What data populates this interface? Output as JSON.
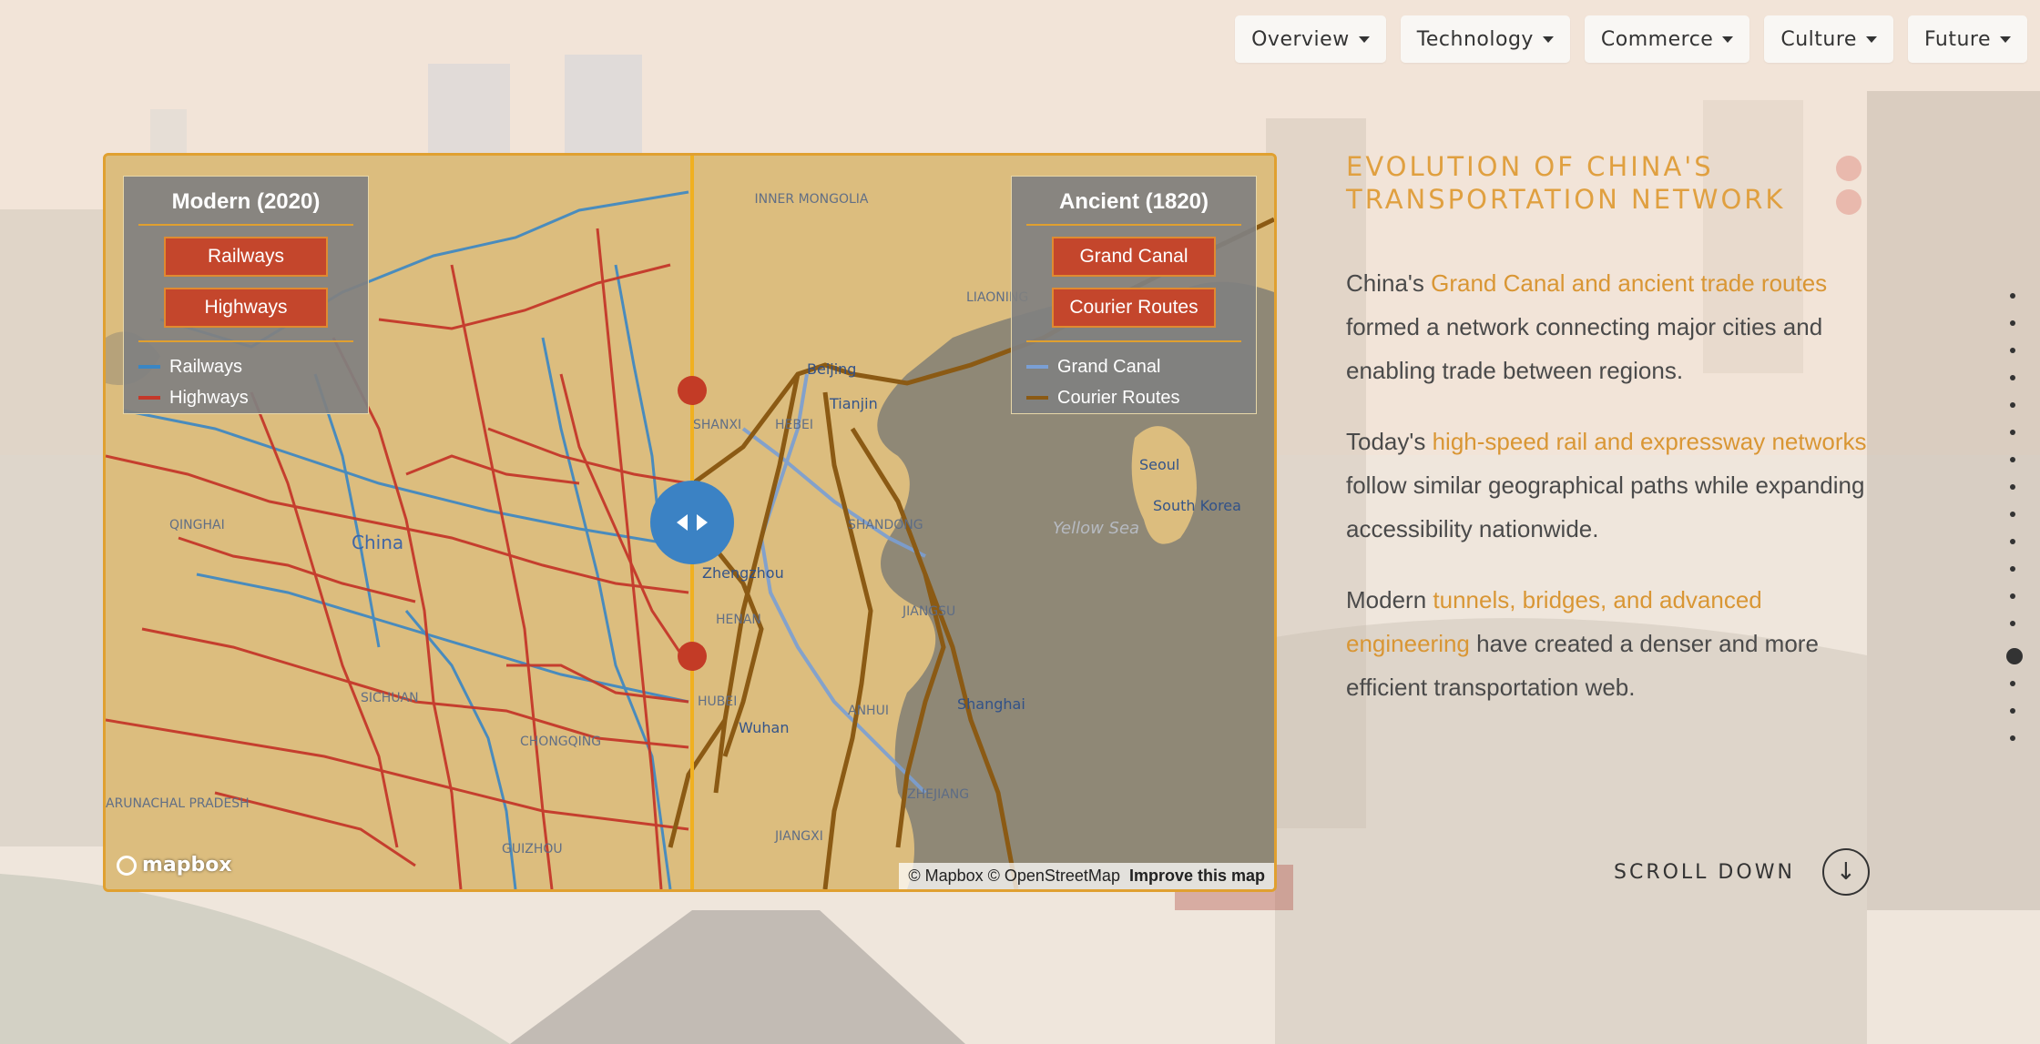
{
  "nav": [
    {
      "label": "Overview"
    },
    {
      "label": "Technology"
    },
    {
      "label": "Commerce"
    },
    {
      "label": "Culture"
    },
    {
      "label": "Future"
    }
  ],
  "map": {
    "modern_legend": {
      "title": "Modern (2020)",
      "buttons": [
        "Railways",
        "Highways"
      ],
      "items": [
        {
          "label": "Railways",
          "color": "#3a86c4"
        },
        {
          "label": "Highways",
          "color": "#c4382a"
        }
      ]
    },
    "ancient_legend": {
      "title": "Ancient (1820)",
      "buttons": [
        "Grand Canal",
        "Courier Routes"
      ],
      "items": [
        {
          "label": "Grand Canal",
          "color": "#7a9fd4"
        },
        {
          "label": "Courier Routes",
          "color": "#8b5a14"
        }
      ]
    },
    "place_labels": [
      "INNER MONGOLIA",
      "Beijing",
      "Tianjin",
      "LIAONING",
      "HEBEI",
      "SHANXI",
      "SHANDONG",
      "Seoul",
      "South Korea",
      "Yellow Sea",
      "QINGHAI",
      "China",
      "Zhengzhou",
      "HENAN",
      "JIANGSU",
      "Shanghai",
      "Wuhan",
      "HUBEI",
      "ANHUI",
      "SICHUAN",
      "CHONGQING",
      "ZHEJIANG",
      "JIANGXI",
      "GUIZHOU",
      "ARUNACHAL PRADESH"
    ],
    "logo_text": "mapbox",
    "attribution": "© Mapbox © OpenStreetMap",
    "improve_link": "Improve this map"
  },
  "content": {
    "heading": "EVOLUTION OF CHINA'S TRANSPORTATION NETWORK",
    "p1_pre": "China's ",
    "p1_hl": "Grand Canal and ancient trade routes",
    "p1_post": " formed a network connecting major cities and enabling trade between regions.",
    "p2_pre": "Today's ",
    "p2_hl": "high-speed rail and expressway networks",
    "p2_post": " follow similar geographical paths while expanding accessibility nationwide.",
    "p3_pre": "Modern ",
    "p3_hl": "tunnels, bridges, and advanced engineering",
    "p3_post": " have created a denser and more efficient transportation web."
  },
  "scroll": {
    "label": "SCROLL DOWN",
    "icon": "arrow-down-icon"
  },
  "section_dots": {
    "count": 17,
    "active_index": 13
  }
}
